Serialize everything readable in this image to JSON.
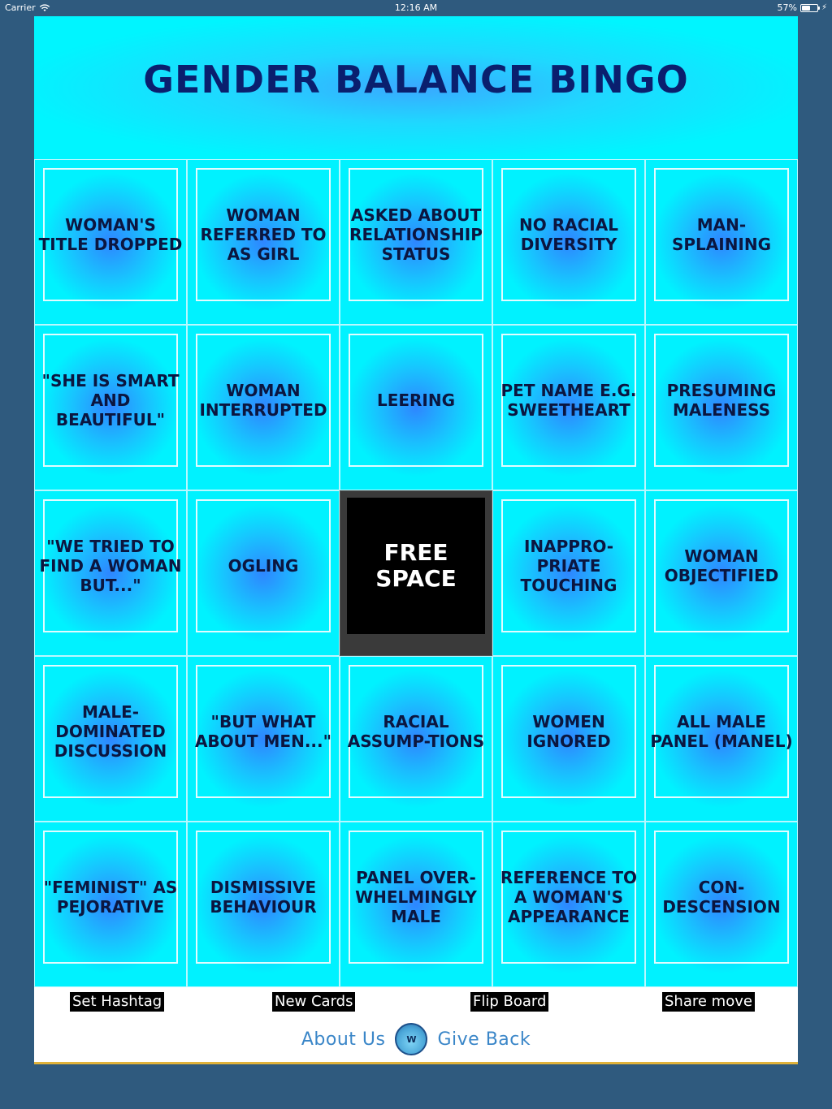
{
  "status_bar": {
    "carrier": "Carrier",
    "time": "12:16 AM",
    "battery": "57%",
    "battery_level": 0.57
  },
  "header": {
    "title": "GENDER BALANCE BINGO"
  },
  "board": {
    "cells": [
      "WOMAN'S TITLE DROPPED",
      "WOMAN REFERRED TO AS GIRL",
      "ASKED ABOUT RELATIONSHIP STATUS",
      "NO RACIAL DIVERSITY",
      "MAN-SPLAINING",
      "\"SHE IS SMART AND BEAUTIFUL\"",
      "WOMAN INTERRUPTED",
      "LEERING",
      "PET NAME E.G. SWEETHEART",
      "PRESUMING MALENESS",
      "\"WE TRIED TO FIND A WOMAN BUT...\"",
      "OGLING",
      "FREE SPACE",
      "INAPPRO-PRIATE TOUCHING",
      "WOMAN OBJECTIFIED",
      "MALE-DOMINATED DISCUSSION",
      "\"BUT WHAT ABOUT MEN...\"",
      "RACIAL ASSUMP-TIONS",
      "WOMEN IGNORED",
      "ALL MALE PANEL (MANEL)",
      "\"FEMINIST\" AS PEJORATIVE",
      "DISMISSIVE BEHAVIOUR",
      "PANEL OVER-WHELMINGLY MALE",
      "REFERENCE TO A WOMAN'S APPEARANCE",
      "CON-DESCENSION"
    ]
  },
  "controls": {
    "set_hashtag": "Set Hashtag",
    "new_cards": "New Cards",
    "flip_board": "Flip Board",
    "share_move": "Share move"
  },
  "footer": {
    "about_us": "About Us",
    "give_back": "Give Back",
    "logo_icon": "water-logo-icon"
  },
  "colors": {
    "background": "#2f5a7e",
    "board": "#00f2ff",
    "title": "#0a1f6e",
    "free_space": "#000000",
    "link": "#3a86c8"
  }
}
